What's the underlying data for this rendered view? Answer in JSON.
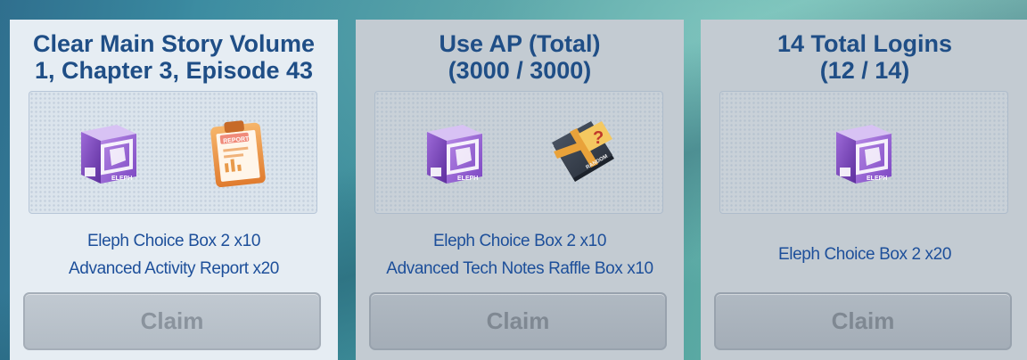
{
  "missions": [
    {
      "title": "Clear Main Story Volume 1, Chapter 3, Episode 43",
      "title_line1": "Clear Main Story Volume",
      "title_line2": "1, Chapter 3, Episode 43",
      "icons": [
        "eleph-choice-box-icon",
        "activity-report-icon"
      ],
      "rewards": [
        "Eleph Choice Box 2 x10",
        "Advanced Activity Report x20"
      ],
      "claim_label": "Claim",
      "state": "active"
    },
    {
      "title_line1": "Use AP (Total)",
      "title_line2": "(3000 / 3000)",
      "icons": [
        "eleph-choice-box-icon",
        "tech-notes-raffle-box-icon"
      ],
      "rewards": [
        "Eleph Choice Box 2 x10",
        "Advanced Tech Notes Raffle Box x10"
      ],
      "claim_label": "Claim",
      "state": "inactive"
    },
    {
      "title_line1": "14 Total Logins",
      "title_line2": "(12 / 14)",
      "icons": [
        "eleph-choice-box-icon"
      ],
      "rewards": [
        "Eleph Choice Box 2 x20"
      ],
      "claim_label": "Claim",
      "state": "inactive"
    }
  ],
  "icon_text": {
    "box_brand": "ELEPH",
    "report": "REPORT",
    "random": "RANDOM",
    "question": "?"
  },
  "colors": {
    "title": "#1f4e86",
    "reward_text": "#1d4f9a",
    "card_active": "#e6edf3",
    "card_inactive": "#c3cbd2",
    "claim_text": "#8a939d"
  }
}
